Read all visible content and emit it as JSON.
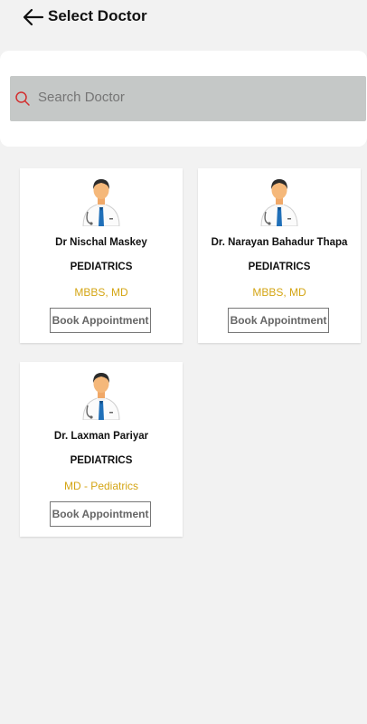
{
  "header": {
    "title": "Select Doctor",
    "back_icon": "arrow-left-icon"
  },
  "search": {
    "placeholder": "Search Doctor",
    "icon": "search-icon",
    "icon_color": "#d32f2f"
  },
  "doctors": [
    {
      "name": "Dr Nischal Maskey",
      "specialty": "PEDIATRICS",
      "qualification": "MBBS, MD",
      "button": "Book Appointment"
    },
    {
      "name": "Dr. Narayan Bahadur Thapa",
      "specialty": "PEDIATRICS",
      "qualification": "MBBS, MD",
      "button": "Book Appointment"
    },
    {
      "name": "Dr. Laxman Pariyar",
      "specialty": "PEDIATRICS",
      "qualification": "MD - Pediatrics",
      "button": "Book Appointment"
    }
  ],
  "colors": {
    "qualification": "#d4a514",
    "search_bar": "#c5c8c7",
    "background": "#f2f2f2"
  }
}
